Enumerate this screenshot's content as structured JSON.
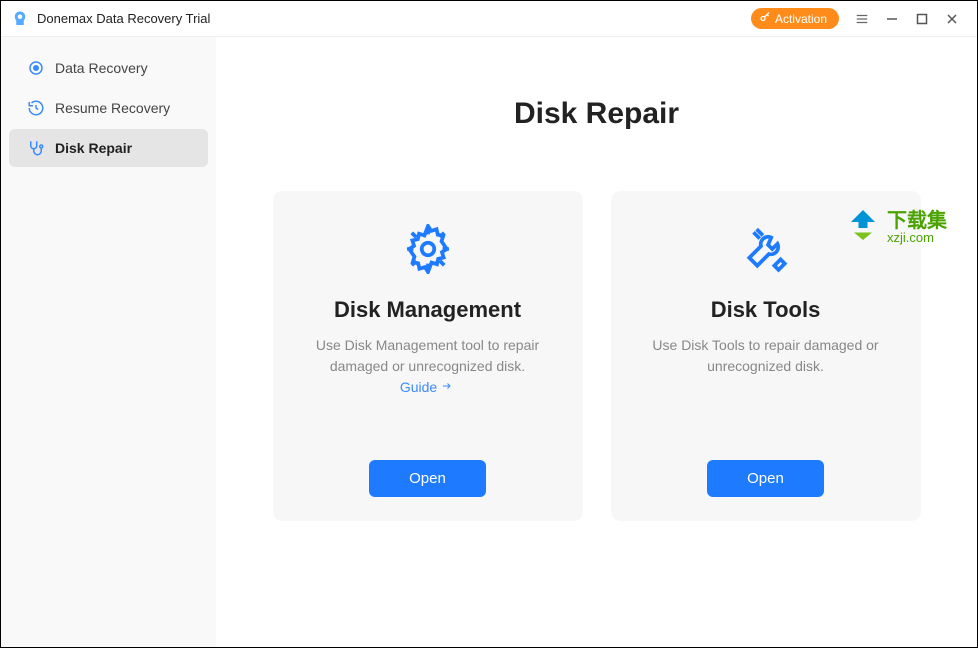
{
  "titlebar": {
    "app_title": "Donemax Data Recovery Trial",
    "activation_label": "Activation"
  },
  "sidebar": {
    "items": [
      {
        "label": "Data Recovery"
      },
      {
        "label": "Resume Recovery"
      },
      {
        "label": "Disk Repair"
      }
    ]
  },
  "main": {
    "page_title": "Disk Repair",
    "cards": [
      {
        "title": "Disk Management",
        "desc": "Use Disk Management tool to repair damaged or unrecognized disk.",
        "guide": "Guide",
        "open": "Open"
      },
      {
        "title": "Disk Tools",
        "desc": "Use Disk Tools to repair damaged or unrecognized disk.",
        "open": "Open"
      }
    ]
  },
  "watermark": {
    "cn": "下载集",
    "url": "xzji.com"
  }
}
